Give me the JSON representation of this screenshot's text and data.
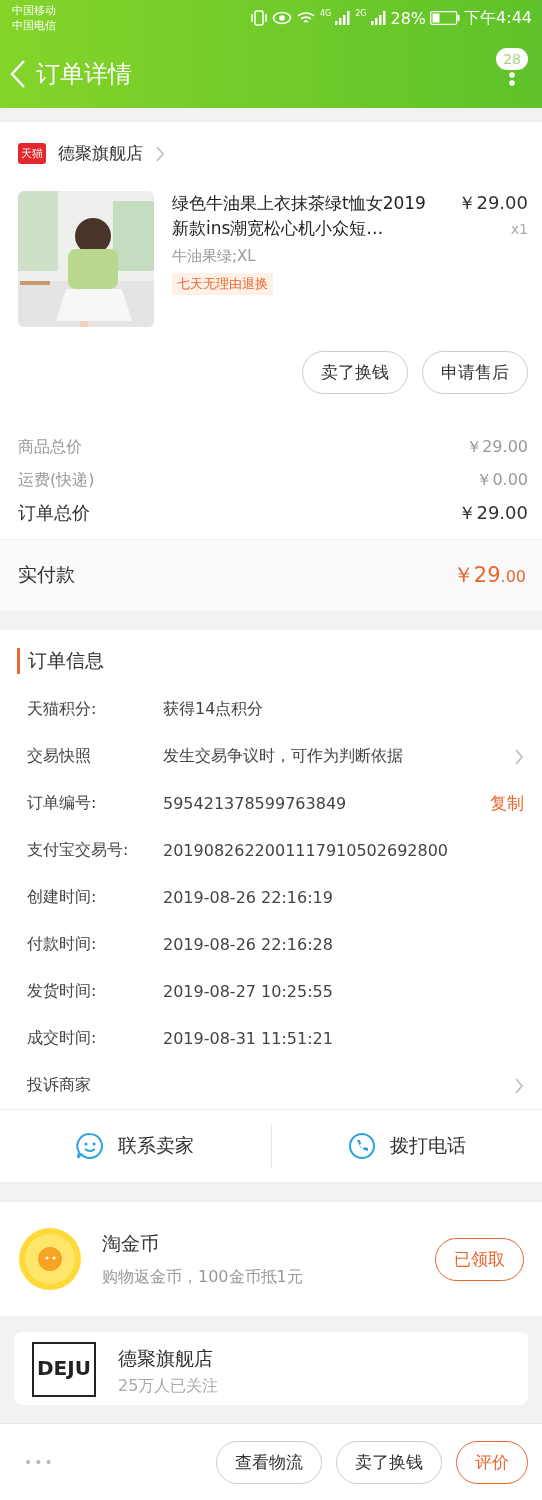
{
  "status_bar": {
    "carriers": [
      "中国移动",
      "中国电信"
    ],
    "network_4g": "4G",
    "network_2g": "2G",
    "battery": "28%",
    "time": "下午4:44"
  },
  "header": {
    "title": "订单详情",
    "badge": "28"
  },
  "store": {
    "badge": "天猫",
    "name": "德聚旗舰店"
  },
  "item": {
    "title": "绿色牛油果上衣抹茶绿t恤女2019新款ins潮宽松心机小众短…",
    "price": "￥29.00",
    "quantity": "x1",
    "sku": "牛油果绿;XL",
    "tag": "七天无理由退换"
  },
  "item_buttons": [
    "卖了换钱",
    "申请售后"
  ],
  "summary": [
    {
      "label": "商品总价",
      "value": "￥29.00",
      "kind": "minor"
    },
    {
      "label": "运费(快递)",
      "value": "￥0.00",
      "kind": "minor"
    },
    {
      "label": "订单总价",
      "value": "￥29.00",
      "kind": "major"
    }
  ],
  "paid": {
    "label": "实付款",
    "amount": "￥29",
    "decimals": ".00"
  },
  "order_info": {
    "title": "订单信息",
    "rows": [
      {
        "label": "天猫积分:",
        "value": "获得14点积分"
      },
      {
        "label": "交易快照",
        "value": "发生交易争议时，可作为判断依据",
        "kind": "link"
      },
      {
        "label": "订单编号:",
        "value": "595421378599763849",
        "action": "复制"
      },
      {
        "label": "支付宝交易号:",
        "value": "2019082622001117910502692800"
      },
      {
        "label": "创建时间:",
        "value": "2019-08-26 22:16:19"
      },
      {
        "label": "付款时间:",
        "value": "2019-08-26 22:16:28"
      },
      {
        "label": "发货时间:",
        "value": "2019-08-27 10:25:55"
      },
      {
        "label": "成交时间:",
        "value": "2019-08-31 11:51:21"
      },
      {
        "label": "投诉商家",
        "kind": "link"
      }
    ]
  },
  "contact": [
    {
      "label": "联系卖家",
      "kind": "chat"
    },
    {
      "label": "拨打电话",
      "kind": "phone"
    }
  ],
  "coins": {
    "title": "淘金币",
    "subtitle": "购物返金币，100金币抵1元",
    "button": "已领取"
  },
  "shop_card": {
    "logo": "DEJU",
    "name": "德聚旗舰店",
    "followers": "25万人已关注"
  },
  "bottom_bar": {
    "more": "•••",
    "buttons": [
      {
        "label": "查看物流",
        "kind": "plain"
      },
      {
        "label": "卖了换钱",
        "kind": "plain"
      },
      {
        "label": "评价",
        "kind": "accent"
      }
    ]
  }
}
